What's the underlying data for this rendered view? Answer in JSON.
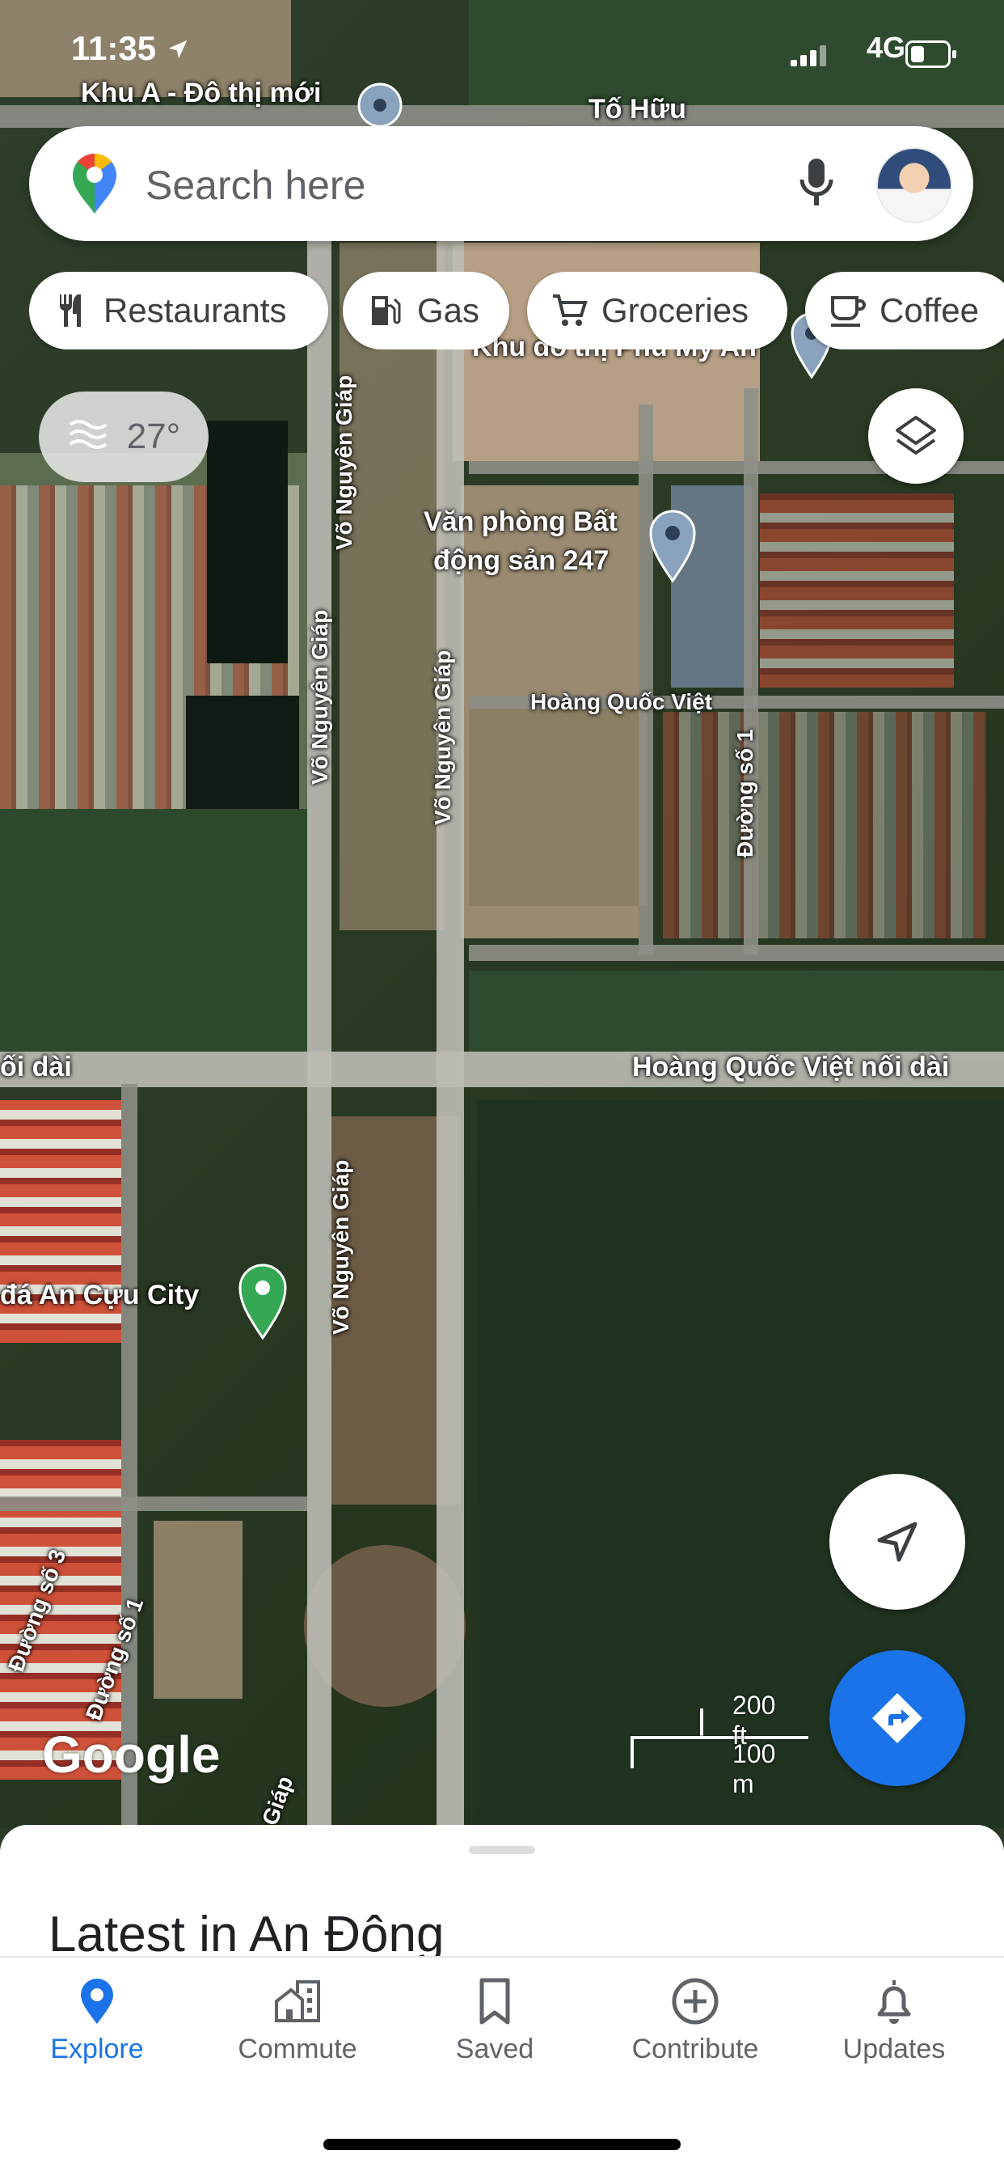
{
  "status_bar": {
    "time": "11:35",
    "network": "4G"
  },
  "search": {
    "placeholder": "Search here"
  },
  "chips": [
    {
      "label": "Restaurants",
      "icon": "restaurant-icon"
    },
    {
      "label": "Gas",
      "icon": "gas-station-icon"
    },
    {
      "label": "Groceries",
      "icon": "cart-icon"
    },
    {
      "label": "Coffee",
      "icon": "coffee-icon"
    }
  ],
  "weather": {
    "temperature": "27°"
  },
  "map": {
    "labels": {
      "khu_a": "Khu A - Đô thị mới",
      "to_huu": "Tố Hữu",
      "khu_do_thi": "Khu đô thị Phú Mỹ An",
      "van_phong_line1": "Văn phòng Bất",
      "van_phong_line2": "động sản 247",
      "hoang_quoc_viet": "Hoàng Quốc Việt",
      "duong_so_1": "Đường số 1",
      "vo_nguyen_giap_1": "Võ Nguyên Giáp",
      "vo_nguyen_giap_2": "Võ Nguyên Giáp",
      "vo_nguyen_giap_3": "Võ Nguyên Giáp",
      "vo_nguyen_giap_4": "Võ Nguyên Giáp",
      "noi_dai_left": "ối dài",
      "hoang_quoc_viet_noi_dai": "Hoàng Quốc Việt nối dài",
      "an_cuu_city": "đá An Cựu City",
      "duong_so_3": "Đường số 3",
      "duong_so_1_b": "Đường số 1",
      "giap_bottom": "Giáp"
    },
    "scale": {
      "feet": "200 ft",
      "meters": "100 m"
    },
    "logo": "Google"
  },
  "sheet": {
    "title": "Latest in An Đông"
  },
  "nav": {
    "items": [
      {
        "label": "Explore",
        "icon": "explore-pin-icon",
        "active": true
      },
      {
        "label": "Commute",
        "icon": "commute-icon",
        "active": false
      },
      {
        "label": "Saved",
        "icon": "bookmark-icon",
        "active": false
      },
      {
        "label": "Contribute",
        "icon": "add-circle-icon",
        "active": false
      },
      {
        "label": "Updates",
        "icon": "bell-icon",
        "active": false
      }
    ]
  },
  "colors": {
    "accent": "#1a73e8",
    "text_secondary": "#5f6368"
  }
}
